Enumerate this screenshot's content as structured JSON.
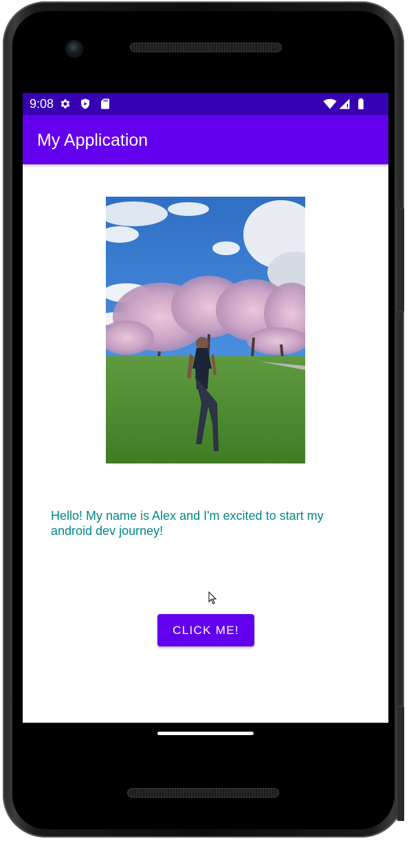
{
  "status_bar": {
    "time": "9:08",
    "left_icons": [
      "gear-icon",
      "shield-play-icon",
      "sd-card-icon"
    ],
    "right_icons": [
      "wifi-icon",
      "signal-icon",
      "battery-icon"
    ],
    "color": "#3700b3"
  },
  "app_bar": {
    "title": "My Application",
    "color": "#6200ee"
  },
  "main": {
    "photo": {
      "alt": "Person standing in a grassy park with cherry blossom trees under a blue sky"
    },
    "message": "Hello! My name is Alex and I'm excited to start my android dev journey!",
    "message_color": "#018786",
    "button_label": "CLICK ME!",
    "button_color": "#6200ee"
  }
}
